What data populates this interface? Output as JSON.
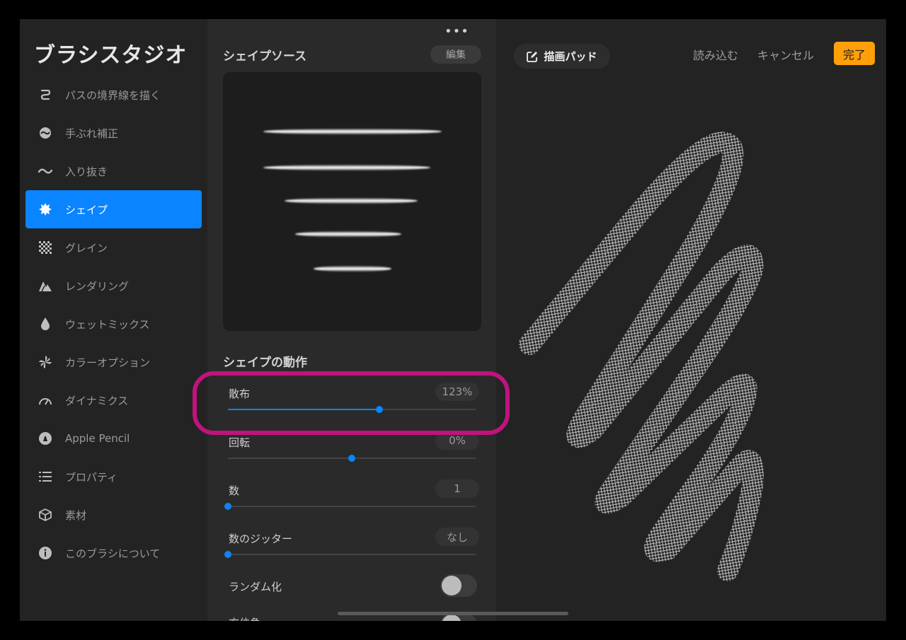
{
  "app_title": "ブラシスタジオ",
  "sidebar": {
    "items": [
      {
        "label": "パスの境界線を描く",
        "icon": "stroke-path-icon"
      },
      {
        "label": "手ぶれ補正",
        "icon": "stabilization-icon"
      },
      {
        "label": "入り抜き",
        "icon": "taper-icon"
      },
      {
        "label": "シェイプ",
        "icon": "shape-icon",
        "active": true
      },
      {
        "label": "グレイン",
        "icon": "grain-icon"
      },
      {
        "label": "レンダリング",
        "icon": "rendering-icon"
      },
      {
        "label": "ウェットミックス",
        "icon": "wet-mix-icon"
      },
      {
        "label": "カラーオプション",
        "icon": "color-options-icon"
      },
      {
        "label": "ダイナミクス",
        "icon": "dynamics-icon"
      },
      {
        "label": "Apple Pencil",
        "icon": "apple-pencil-icon"
      },
      {
        "label": "プロパティ",
        "icon": "properties-icon"
      },
      {
        "label": "素材",
        "icon": "materials-icon"
      },
      {
        "label": "このブラシについて",
        "icon": "info-icon"
      }
    ]
  },
  "panel": {
    "shape_source_title": "シェイプソース",
    "edit_label": "編集",
    "behavior_title": "シェイプの動作",
    "sliders": [
      {
        "label": "散布",
        "value": "123%",
        "fraction": 0.61
      },
      {
        "label": "回転",
        "value": "0%",
        "fraction": 0.5
      },
      {
        "label": "数",
        "value": "1",
        "fraction": 0.0
      },
      {
        "label": "数のジッター",
        "value": "なし",
        "fraction": 0.0
      }
    ],
    "randomize_label": "ランダム化",
    "randomize_on": false,
    "cutoff_label": "方位角"
  },
  "header": {
    "drawpad_label": "描画パッド",
    "import_label": "読み込む",
    "cancel_label": "キャンセル",
    "done_label": "完了"
  },
  "colors": {
    "accent": "#0a84ff",
    "done": "#ff9f0a",
    "highlight": "#c0137d"
  }
}
